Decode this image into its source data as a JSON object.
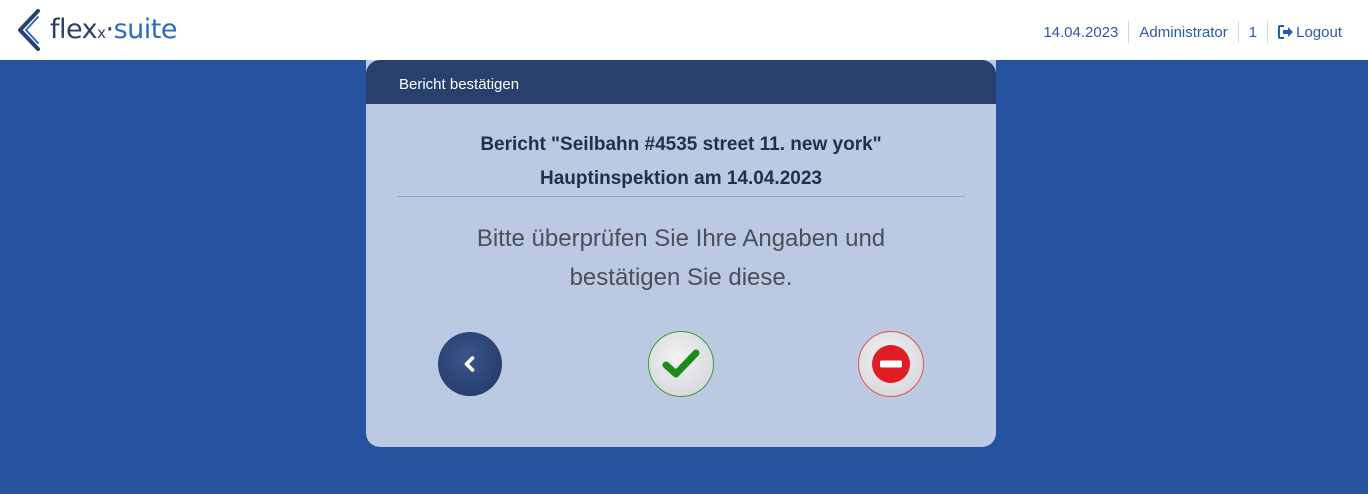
{
  "header": {
    "logo": {
      "brand_left": "flex",
      "brand_x": "x",
      "brand_dot": "·",
      "brand_right": "suite"
    },
    "date": "14.04.2023",
    "user": "Administrator",
    "count": "1",
    "logout_label": "Logout"
  },
  "dialog": {
    "title": "Bericht bestätigen",
    "report_line": "Bericht \"Seilbahn #4535 street 11. new york\"",
    "inspection_line": "Hauptinspektion am 14.04.2023",
    "message_line1": "Bitte überprüfen Sie Ihre Angaben und",
    "message_line2": "bestätigen Sie diese.",
    "actions": [
      {
        "name": "back",
        "icon": "chevron-left-icon",
        "color": "#2a4274"
      },
      {
        "name": "confirm",
        "icon": "checkmark-icon",
        "color": "#1e8a1c"
      },
      {
        "name": "cancel",
        "icon": "minus-circle-icon",
        "color": "#e01c24"
      }
    ]
  },
  "colors": {
    "background": "#2653a0",
    "dialog_header": "#28406e",
    "dialog_body": "#bcc9e2",
    "link": "#2b5aa8"
  }
}
